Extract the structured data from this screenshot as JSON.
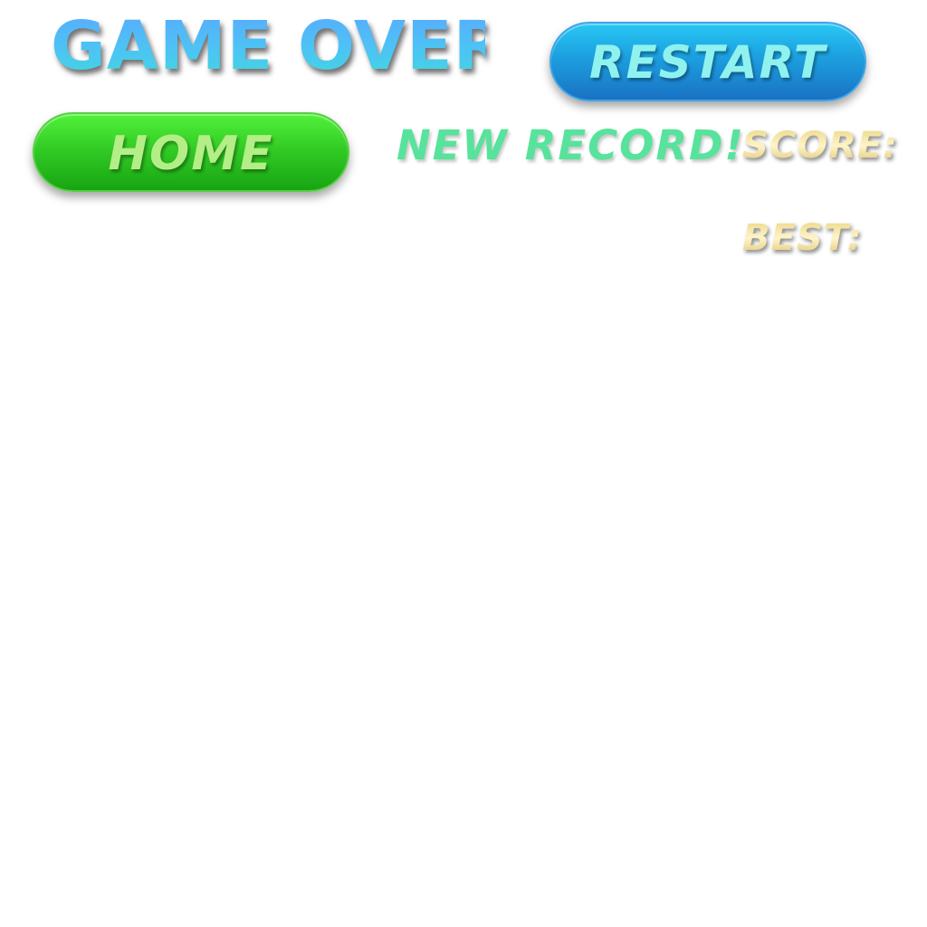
{
  "title": "GAME OVER",
  "buttons": {
    "restart_label": "RESTART",
    "home_label": "HOME"
  },
  "record_label": "NEW RECORD!",
  "stats": {
    "score_label": "SCORE:",
    "best_label": "BEST:"
  },
  "colors": {
    "title": "#4cc4f4",
    "restart_button": "#1c9fdf",
    "home_button": "#33cc26",
    "record_text": "#57e39b",
    "stat_text": "#e6cf72"
  }
}
